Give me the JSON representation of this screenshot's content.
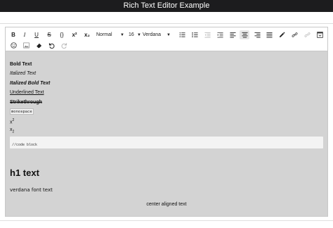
{
  "window": {
    "title": "Rich Text Editor Example"
  },
  "toolbar": {
    "bold_label": "B",
    "italic_label": "I",
    "underline_label": "U",
    "strike_label": "S",
    "code_label": "{}",
    "superscript_label": "x²",
    "subscript_label": "x₂",
    "block_type": "Normal",
    "font_size": "16",
    "font_family": "Verdana",
    "icons": [
      "bold-icon",
      "italic-icon",
      "underline-icon",
      "strikethrough-icon",
      "code-icon",
      "superscript-icon",
      "subscript-icon",
      "unordered-list-icon",
      "ordered-list-icon",
      "outdent-icon",
      "indent-icon",
      "align-left-icon",
      "align-center-icon",
      "align-right-icon",
      "align-justify-icon",
      "color-picker-icon",
      "link-icon",
      "unlink-icon",
      "embed-icon",
      "emoji-icon",
      "image-icon",
      "eraser-icon",
      "undo-icon",
      "redo-icon"
    ]
  },
  "content": {
    "bold": "Bold Text",
    "italic": "Italized Text",
    "bold_italic": "Italized Bold Text",
    "underline": "Underlined Text",
    "strikethrough": "Strikethrough",
    "monospace": "monospace",
    "superscript_base": "x",
    "superscript_exp": "2",
    "subscript_base": "x",
    "subscript_idx": "2",
    "code_block": "//code block",
    "h1": "h1 text",
    "verdana": "verdana font text",
    "centered": "center aligned text"
  },
  "colors": {
    "titlebar": "#1c1c1e",
    "editor_bg": "#d3d3d3",
    "toolbar_bg": "#ffffff"
  }
}
